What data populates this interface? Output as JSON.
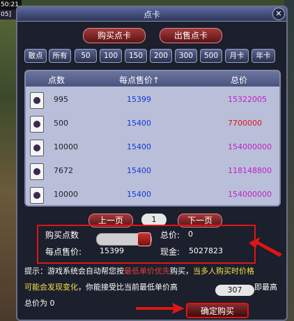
{
  "game_hud": {
    "clock": "50:21",
    "id_fragment": "05]"
  },
  "window": {
    "title": "点卡",
    "close_symbol": "✕"
  },
  "tabs": {
    "buy": "购买点卡",
    "sell": "出售点卡"
  },
  "filters": [
    "散点",
    "所有",
    "50",
    "100",
    "150",
    "200",
    "300",
    "500",
    "月卡",
    "年卡"
  ],
  "table": {
    "headers": {
      "points": "点数",
      "price": "每点售价↑",
      "total": "总价"
    },
    "rows": [
      {
        "points": "995",
        "price": "15399",
        "total": "15322005",
        "total_color": "#c21ec8"
      },
      {
        "points": "500",
        "price": "15400",
        "total": "7700000",
        "total_color": "#e01515"
      },
      {
        "points": "10000",
        "price": "15400",
        "total": "154000000",
        "total_color": "#c21ec8"
      },
      {
        "points": "7672",
        "price": "15400",
        "total": "118148800",
        "total_color": "#c21ec8"
      },
      {
        "points": "10000",
        "price": "15400",
        "total": "154000000",
        "total_color": "#c21ec8"
      }
    ]
  },
  "pager": {
    "prev": "上一页",
    "page": "1",
    "next": "下一页"
  },
  "purchase": {
    "points_label": "购买点数",
    "total_label": "总价:",
    "total_value": "0",
    "unit_price_label": "每点售价:",
    "unit_price_value": "15399",
    "cash_label": "现金:",
    "cash_value": "5027823"
  },
  "tip": {
    "line1_a": "提示：游戏系统会自动帮您按",
    "line1_b": "最低单价优先",
    "line1_c": "购买，",
    "line1_d": "当多人购买时价格",
    "line2_a": "可能会发现变化",
    "line2_b": "，你能接受比当前最低单价高",
    "accept_value": "307",
    "line2_c": "即最高",
    "line3": "总价为 0"
  },
  "confirm_label": "确定购买",
  "colors": {
    "yellow": "#f0e04a",
    "red": "#e8413a",
    "green_yellow": "#c8e83a"
  }
}
